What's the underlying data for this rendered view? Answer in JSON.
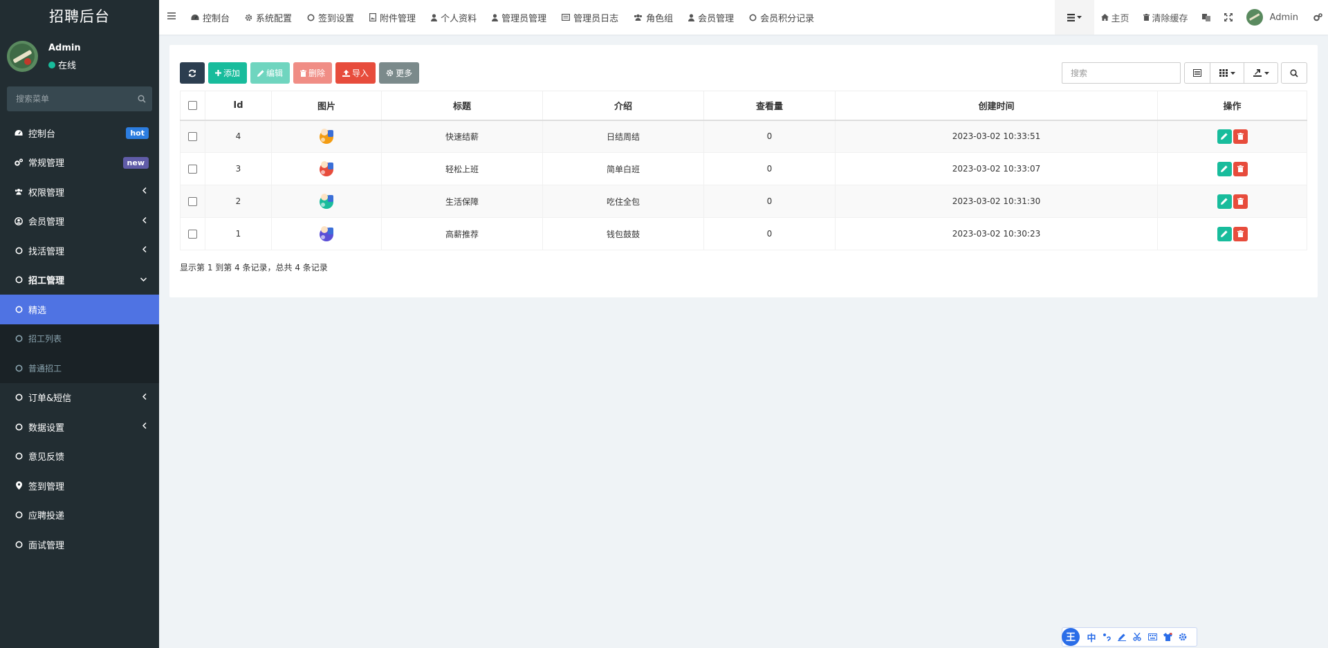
{
  "app": {
    "title": "招聘后台"
  },
  "user": {
    "name": "Admin",
    "status": "在线"
  },
  "menu_search": {
    "placeholder": "搜索菜单"
  },
  "sidebar": {
    "items": [
      {
        "label": "控制台",
        "icon": "dashboard-icon",
        "badge": "hot",
        "badge_color": "#2c7de0"
      },
      {
        "label": "常规管理",
        "icon": "cogs-icon",
        "badge": "new",
        "badge_color": "#605ca8"
      },
      {
        "label": "权限管理",
        "icon": "group-icon",
        "chevron": "left"
      },
      {
        "label": "会员管理",
        "icon": "user-circle-icon",
        "chevron": "left"
      },
      {
        "label": "找活管理",
        "icon": "circle-icon",
        "chevron": "left"
      },
      {
        "label": "招工管理",
        "icon": "circle-icon",
        "chevron": "down",
        "open": true
      },
      {
        "label": "精选",
        "icon": "circle-icon",
        "active": true
      },
      {
        "label": "招工列表",
        "icon": "circle-icon",
        "sub": true
      },
      {
        "label": "普通招工",
        "icon": "circle-icon",
        "sub": true
      },
      {
        "label": "订单&短信",
        "icon": "circle-icon",
        "chevron": "left"
      },
      {
        "label": "数据设置",
        "icon": "circle-icon",
        "chevron": "left"
      },
      {
        "label": "意见反馈",
        "icon": "circle-icon"
      },
      {
        "label": "签到管理",
        "icon": "map-marker-icon"
      },
      {
        "label": "应聘投递",
        "icon": "circle-icon"
      },
      {
        "label": "面试管理",
        "icon": "circle-icon"
      }
    ]
  },
  "topbar": {
    "tabs": [
      {
        "label": "控制台",
        "icon": "dashboard-icon"
      },
      {
        "label": "系统配置",
        "icon": "gear-icon"
      },
      {
        "label": "签到设置",
        "icon": "circle-icon"
      },
      {
        "label": "附件管理",
        "icon": "file-image-icon"
      },
      {
        "label": "个人资料",
        "icon": "user-icon"
      },
      {
        "label": "管理员管理",
        "icon": "user-icon"
      },
      {
        "label": "管理员日志",
        "icon": "list-alt-icon"
      },
      {
        "label": "角色组",
        "icon": "group-icon"
      },
      {
        "label": "会员管理",
        "icon": "user-icon"
      },
      {
        "label": "会员积分记录",
        "icon": "circle-icon"
      }
    ],
    "right": {
      "home": "主页",
      "clear_cache": "清除缓存",
      "admin": "Admin"
    }
  },
  "toolbar": {
    "add": "添加",
    "edit": "编辑",
    "delete": "删除",
    "import": "导入",
    "more": "更多"
  },
  "search": {
    "placeholder": "搜索"
  },
  "table": {
    "columns": [
      "Id",
      "图片",
      "标题",
      "介绍",
      "查看量",
      "创建时间",
      "操作"
    ],
    "rows": [
      {
        "id": "4",
        "title": "快速结薪",
        "intro": "日结周结",
        "views": "0",
        "created": "2023-03-02 10:33:51",
        "thumb_color": "#f39c12"
      },
      {
        "id": "3",
        "title": "轻松上班",
        "intro": "简单白班",
        "views": "0",
        "created": "2023-03-02 10:33:07",
        "thumb_color": "#e74c3c"
      },
      {
        "id": "2",
        "title": "生活保障",
        "intro": "吃住全包",
        "views": "0",
        "created": "2023-03-02 10:31:30",
        "thumb_color": "#1abc9c"
      },
      {
        "id": "1",
        "title": "高薪推荐",
        "intro": "钱包鼓鼓",
        "views": "0",
        "created": "2023-03-02 10:30:23",
        "thumb_color": "#5b4fd6"
      }
    ]
  },
  "pager": {
    "summary": "显示第 1 到第 4 条记录，总共 4 条记录"
  },
  "ime": {
    "logo": "王",
    "lang": "中"
  }
}
